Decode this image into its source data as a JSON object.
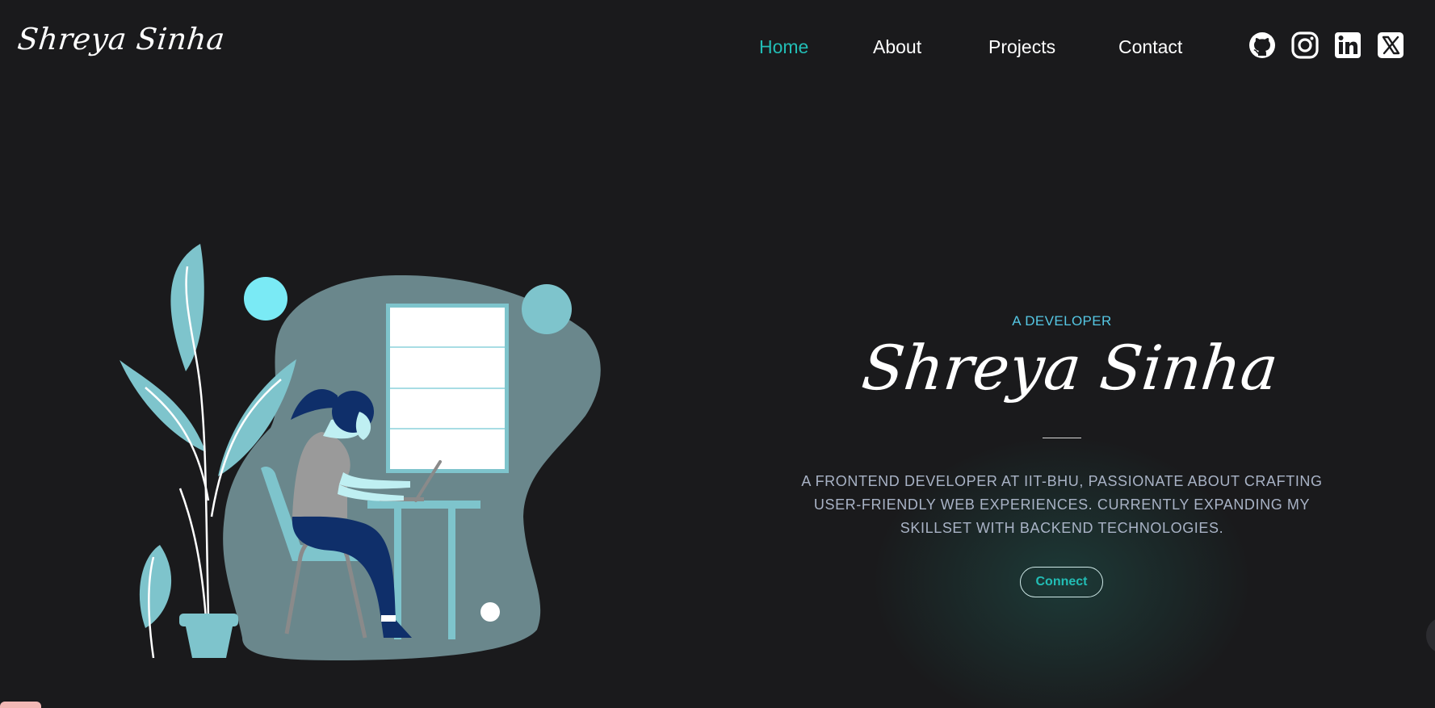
{
  "header": {
    "logo": "Shreya Sinha",
    "nav": [
      {
        "label": "Home",
        "active": true
      },
      {
        "label": "About",
        "active": false
      },
      {
        "label": "Projects",
        "active": false
      },
      {
        "label": "Contact",
        "active": false
      }
    ],
    "social_icons": [
      "github-icon",
      "instagram-icon",
      "linkedin-icon",
      "x-icon"
    ]
  },
  "hero": {
    "eyebrow": "A DEVELOPER",
    "name": "Shreya Sinha",
    "bio": "A FRONTEND DEVELOPER AT IIT-BHU, PASSIONATE ABOUT CRAFTING USER-FRIENDLY WEB EXPERIENCES. CURRENTLY EXPANDING MY SKILLSET WITH BACKEND TECHNOLOGIES.",
    "cta_label": "Connect"
  },
  "colors": {
    "background": "#1a1a1c",
    "accent": "#22bdb5",
    "eyebrow": "#55c7e4",
    "bio_text": "#a9b3c6",
    "illustration_blob": "#6a878c",
    "illustration_teal": "#7ec4cc"
  }
}
